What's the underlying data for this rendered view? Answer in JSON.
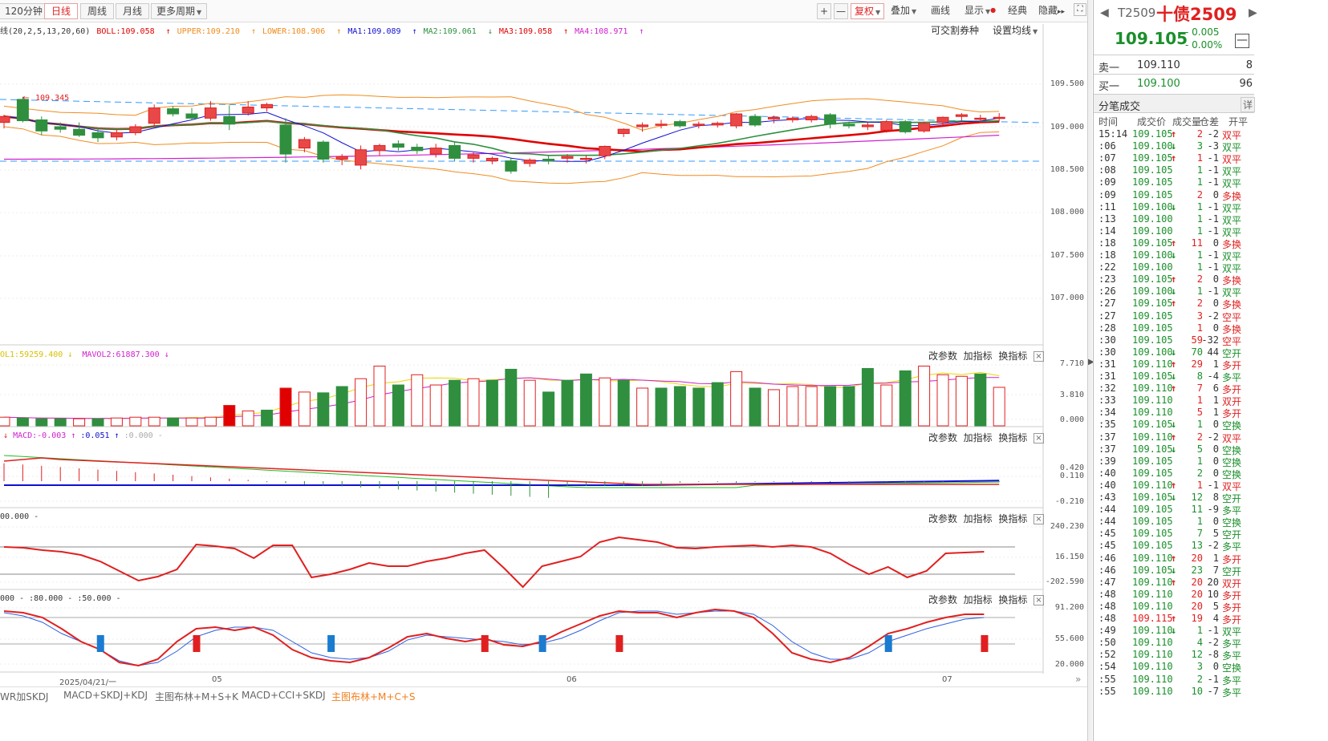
{
  "toolbar": {
    "period_tabs": [
      "120分钟",
      "日线",
      "周线",
      "月线",
      "更多周期"
    ],
    "active_period": "日线",
    "tools": [
      "复权",
      "叠加",
      "画线",
      "显示",
      "经典",
      "隐藏"
    ],
    "plus": "+",
    "minus": "—"
  },
  "main_indicator": {
    "boll": "线(20,2,5,13,20,60)",
    "boll_val": "BOLL:109.058",
    "upper": "UPPER:109.210",
    "lower": "LOWER:108.906",
    "ma1": "MA1:109.089",
    "ma2": "MA2:109.061",
    "ma3": "MA3:109.058",
    "ma4": "MA4:108.971",
    "tradable": "可交割券种",
    "set_ma": "设置均线",
    "high_mark": "109.345"
  },
  "price_axis": [
    "109.500",
    "109.000",
    "108.500",
    "108.000",
    "107.500",
    "107.000"
  ],
  "volume_panel": {
    "vol1": "OL1:59259.400",
    "mavol2": "MAVOL2:61887.300",
    "axis": [
      "7.710",
      "3.810",
      "0.000"
    ]
  },
  "macd_panel": {
    "macd": "MACD:-0.003",
    "dif": ":0.051",
    "dea": ":0.000",
    "axis": [
      "0.420",
      "0.110",
      "-0.210"
    ]
  },
  "cci_panel": {
    "label": "00.000",
    "axis": [
      "240.230",
      "16.150",
      "-202.590"
    ]
  },
  "kdj_panel": {
    "label1": "000",
    "label2": ":80.000",
    "label3": ":50.000",
    "axis": [
      "91.200",
      "55.600",
      "20.000"
    ]
  },
  "panel_controls": {
    "params": "改参数",
    "add": "加指标",
    "switch": "换指标",
    "close": "×"
  },
  "date_axis": [
    "2025/04/21/一",
    "05",
    "06",
    "07"
  ],
  "bottom_tabs": [
    "WR加SKDJ",
    "MACD+SKDJ+KDJ",
    "主图布林+M+S+K",
    "MACD+CCI+SKDJ",
    "主图布林+M+C+S"
  ],
  "active_bottom_tab": "主图布林+M+C+S",
  "quote": {
    "code": "T2509",
    "name": "十债2509",
    "price": "109.105",
    "change": "- 0.005",
    "change_pct": "- 0.00%",
    "ask_label": "卖一",
    "ask_price": "109.110",
    "ask_vol": "8",
    "bid_label": "买一",
    "bid_price": "109.100",
    "bid_vol": "96",
    "ticks_title": "分笔成交",
    "detail": "详",
    "headers": [
      "时间",
      "成交价",
      "成交量",
      "仓差",
      "开平"
    ]
  },
  "ticks": [
    [
      "15:14",
      "109.105",
      "↑",
      "2",
      "-2",
      "双平",
      "r"
    ],
    [
      ":06",
      "109.100",
      "↓",
      "3",
      "-3",
      "双平",
      "g"
    ],
    [
      ":07",
      "109.105",
      "↑",
      "1",
      "-1",
      "双平",
      "r"
    ],
    [
      ":08",
      "109.105",
      "",
      "1",
      "-1",
      "双平",
      "g"
    ],
    [
      ":09",
      "109.105",
      "",
      "1",
      "-1",
      "双平",
      "g"
    ],
    [
      ":09",
      "109.105",
      "",
      "2",
      "0",
      "多换",
      "r"
    ],
    [
      ":11",
      "109.100",
      "↓",
      "1",
      "-1",
      "双平",
      "g"
    ],
    [
      ":13",
      "109.100",
      "",
      "1",
      "-1",
      "双平",
      "g"
    ],
    [
      ":14",
      "109.100",
      "",
      "1",
      "-1",
      "双平",
      "g"
    ],
    [
      ":18",
      "109.105",
      "↑",
      "11",
      "0",
      "多换",
      "r"
    ],
    [
      ":18",
      "109.100",
      "↓",
      "1",
      "-1",
      "双平",
      "g"
    ],
    [
      ":22",
      "109.100",
      "",
      "1",
      "-1",
      "双平",
      "g"
    ],
    [
      ":23",
      "109.105",
      "↑",
      "2",
      "0",
      "多换",
      "r"
    ],
    [
      ":26",
      "109.100",
      "↓",
      "1",
      "-1",
      "双平",
      "g"
    ],
    [
      ":27",
      "109.105",
      "↑",
      "2",
      "0",
      "多换",
      "r"
    ],
    [
      ":27",
      "109.105",
      "",
      "3",
      "-2",
      "空平",
      "r"
    ],
    [
      ":28",
      "109.105",
      "",
      "1",
      "0",
      "多换",
      "r"
    ],
    [
      ":30",
      "109.105",
      "",
      "59",
      "-32",
      "空平",
      "r"
    ],
    [
      ":30",
      "109.100",
      "↓",
      "70",
      "44",
      "空开",
      "g"
    ],
    [
      ":31",
      "109.110",
      "↑",
      "29",
      "1",
      "多开",
      "r"
    ],
    [
      ":31",
      "109.105",
      "↓",
      "8",
      "-4",
      "多平",
      "g"
    ],
    [
      ":32",
      "109.110",
      "↑",
      "7",
      "6",
      "多开",
      "r"
    ],
    [
      ":33",
      "109.110",
      "",
      "1",
      "1",
      "双开",
      "r"
    ],
    [
      ":34",
      "109.110",
      "",
      "5",
      "1",
      "多开",
      "r"
    ],
    [
      ":35",
      "109.105",
      "↓",
      "1",
      "0",
      "空换",
      "g"
    ],
    [
      ":37",
      "109.110",
      "↑",
      "2",
      "-2",
      "双平",
      "r"
    ],
    [
      ":37",
      "109.105",
      "↓",
      "5",
      "0",
      "空换",
      "g"
    ],
    [
      ":39",
      "109.105",
      "",
      "1",
      "0",
      "空换",
      "g"
    ],
    [
      ":40",
      "109.105",
      "",
      "2",
      "0",
      "空换",
      "g"
    ],
    [
      ":40",
      "109.110",
      "↑",
      "1",
      "-1",
      "双平",
      "r"
    ],
    [
      ":43",
      "109.105",
      "↓",
      "12",
      "8",
      "空开",
      "g"
    ],
    [
      ":44",
      "109.105",
      "",
      "11",
      "-9",
      "多平",
      "g"
    ],
    [
      ":44",
      "109.105",
      "",
      "1",
      "0",
      "空换",
      "g"
    ],
    [
      ":45",
      "109.105",
      "",
      "7",
      "5",
      "空开",
      "g"
    ],
    [
      ":45",
      "109.105",
      "",
      "13",
      "-2",
      "多平",
      "g"
    ],
    [
      ":46",
      "109.110",
      "↑",
      "20",
      "1",
      "多开",
      "r"
    ],
    [
      ":46",
      "109.105",
      "↓",
      "23",
      "7",
      "空开",
      "g"
    ],
    [
      ":47",
      "109.110",
      "↑",
      "20",
      "20",
      "双开",
      "r"
    ],
    [
      ":48",
      "109.110",
      "",
      "20",
      "10",
      "多开",
      "r"
    ],
    [
      ":48",
      "109.110",
      "",
      "20",
      "5",
      "多开",
      "r"
    ],
    [
      ":48",
      "109.115",
      "↑",
      "19",
      "4",
      "多开",
      "r"
    ],
    [
      ":49",
      "109.110",
      "↓",
      "1",
      "-1",
      "双平",
      "g"
    ],
    [
      ":50",
      "109.110",
      "",
      "4",
      "-2",
      "多平",
      "g"
    ],
    [
      ":52",
      "109.110",
      "",
      "12",
      "-8",
      "多平",
      "g"
    ],
    [
      ":54",
      "109.110",
      "",
      "3",
      "0",
      "空换",
      "g"
    ],
    [
      ":55",
      "109.110",
      "",
      "2",
      "-1",
      "多平",
      "g"
    ],
    [
      ":55",
      "109.110",
      "",
      "10",
      "-7",
      "多平",
      "g"
    ]
  ],
  "colors": {
    "up": "#e02020",
    "down": "#2f8f3f",
    "ma1": "#1010d0",
    "upper": "#f08c20",
    "ma4": "#d020d0",
    "boll_mid": "#e00000"
  },
  "chart_data": {
    "type": "candlestick",
    "candles": [
      {
        "o": 109.05,
        "h": 109.14,
        "l": 108.98,
        "c": 109.12
      },
      {
        "o": 109.32,
        "h": 109.35,
        "l": 109.05,
        "c": 109.07
      },
      {
        "o": 109.08,
        "h": 109.12,
        "l": 108.9,
        "c": 108.95
      },
      {
        "o": 109.0,
        "h": 109.05,
        "l": 108.93,
        "c": 108.97
      },
      {
        "o": 108.97,
        "h": 109.05,
        "l": 108.88,
        "c": 108.9
      },
      {
        "o": 108.93,
        "h": 108.98,
        "l": 108.82,
        "c": 108.87
      },
      {
        "o": 108.88,
        "h": 108.96,
        "l": 108.84,
        "c": 108.93
      },
      {
        "o": 108.93,
        "h": 109.03,
        "l": 108.9,
        "c": 109.0
      },
      {
        "o": 109.04,
        "h": 109.26,
        "l": 109.0,
        "c": 109.22
      },
      {
        "o": 109.21,
        "h": 109.24,
        "l": 109.12,
        "c": 109.15
      },
      {
        "o": 109.15,
        "h": 109.22,
        "l": 109.08,
        "c": 109.1
      },
      {
        "o": 109.1,
        "h": 109.3,
        "l": 109.07,
        "c": 109.22
      },
      {
        "o": 109.12,
        "h": 109.25,
        "l": 108.96,
        "c": 109.03
      },
      {
        "o": 109.16,
        "h": 109.3,
        "l": 109.13,
        "c": 109.23
      },
      {
        "o": 109.22,
        "h": 109.28,
        "l": 109.18,
        "c": 109.26
      },
      {
        "o": 109.02,
        "h": 109.1,
        "l": 108.58,
        "c": 108.68
      },
      {
        "o": 108.75,
        "h": 108.88,
        "l": 108.7,
        "c": 108.85
      },
      {
        "o": 108.82,
        "h": 108.84,
        "l": 108.58,
        "c": 108.62
      },
      {
        "o": 108.62,
        "h": 108.68,
        "l": 108.55,
        "c": 108.65
      },
      {
        "o": 108.55,
        "h": 108.78,
        "l": 108.5,
        "c": 108.73
      },
      {
        "o": 108.72,
        "h": 108.8,
        "l": 108.66,
        "c": 108.78
      },
      {
        "o": 108.8,
        "h": 108.84,
        "l": 108.72,
        "c": 108.76
      },
      {
        "o": 108.76,
        "h": 108.8,
        "l": 108.68,
        "c": 108.72
      },
      {
        "o": 108.68,
        "h": 108.8,
        "l": 108.64,
        "c": 108.75
      },
      {
        "o": 108.78,
        "h": 108.82,
        "l": 108.6,
        "c": 108.63
      },
      {
        "o": 108.63,
        "h": 108.7,
        "l": 108.58,
        "c": 108.67
      },
      {
        "o": 108.6,
        "h": 108.65,
        "l": 108.56,
        "c": 108.63
      },
      {
        "o": 108.6,
        "h": 108.64,
        "l": 108.45,
        "c": 108.48
      },
      {
        "o": 108.57,
        "h": 108.63,
        "l": 108.53,
        "c": 108.61
      },
      {
        "o": 108.62,
        "h": 108.66,
        "l": 108.56,
        "c": 108.6
      },
      {
        "o": 108.63,
        "h": 108.68,
        "l": 108.58,
        "c": 108.65
      },
      {
        "o": 108.63,
        "h": 108.66,
        "l": 108.57,
        "c": 108.63
      },
      {
        "o": 108.66,
        "h": 108.78,
        "l": 108.62,
        "c": 108.77
      },
      {
        "o": 108.92,
        "h": 108.98,
        "l": 108.88,
        "c": 108.97
      },
      {
        "o": 109.0,
        "h": 109.05,
        "l": 108.94,
        "c": 109.02
      },
      {
        "o": 109.02,
        "h": 109.08,
        "l": 108.98,
        "c": 109.03
      },
      {
        "o": 109.06,
        "h": 109.08,
        "l": 108.99,
        "c": 109.01
      },
      {
        "o": 109.02,
        "h": 109.06,
        "l": 108.98,
        "c": 109.03
      },
      {
        "o": 109.02,
        "h": 109.06,
        "l": 108.99,
        "c": 109.04
      },
      {
        "o": 109.01,
        "h": 109.16,
        "l": 108.98,
        "c": 109.15
      },
      {
        "o": 109.12,
        "h": 109.15,
        "l": 109.0,
        "c": 109.02
      },
      {
        "o": 109.09,
        "h": 109.13,
        "l": 109.04,
        "c": 109.11
      },
      {
        "o": 109.08,
        "h": 109.12,
        "l": 109.05,
        "c": 109.1
      },
      {
        "o": 109.08,
        "h": 109.14,
        "l": 109.05,
        "c": 109.12
      },
      {
        "o": 109.14,
        "h": 109.16,
        "l": 108.98,
        "c": 109.03
      },
      {
        "o": 109.03,
        "h": 109.06,
        "l": 108.98,
        "c": 109.01
      },
      {
        "o": 109.0,
        "h": 109.05,
        "l": 108.96,
        "c": 109.02
      },
      {
        "o": 108.96,
        "h": 109.08,
        "l": 108.93,
        "c": 109.06
      },
      {
        "o": 109.06,
        "h": 109.08,
        "l": 108.92,
        "c": 108.94
      },
      {
        "o": 108.95,
        "h": 109.06,
        "l": 108.93,
        "c": 109.04
      },
      {
        "o": 109.05,
        "h": 109.12,
        "l": 109.02,
        "c": 109.11
      },
      {
        "o": 109.12,
        "h": 109.16,
        "l": 109.07,
        "c": 109.14
      },
      {
        "o": 109.1,
        "h": 109.14,
        "l": 109.06,
        "c": 109.1
      },
      {
        "o": 109.1,
        "h": 109.16,
        "l": 109.06,
        "c": 109.11
      }
    ],
    "volume_up": [
      1,
      0,
      0,
      0,
      1,
      0,
      1,
      1,
      1,
      0,
      1,
      1,
      1,
      1,
      0,
      1,
      1,
      0,
      0,
      1,
      1,
      0,
      1,
      1,
      0,
      1,
      0,
      0,
      1,
      0,
      0,
      0,
      1,
      0,
      1,
      0,
      0,
      0,
      0,
      1,
      0,
      1,
      1,
      1,
      0,
      0,
      0,
      1,
      0,
      1,
      1,
      1,
      0,
      1
    ],
    "volume": [
      1.1,
      1.0,
      0.9,
      0.9,
      0.9,
      0.9,
      1.0,
      1.1,
      1.1,
      1.0,
      1.0,
      1.1,
      2.6,
      1.9,
      2.0,
      4.8,
      4.3,
      4.2,
      5.0,
      6.0,
      7.6,
      5.2,
      6.5,
      5.2,
      5.8,
      6.0,
      5.8,
      7.2,
      5.8,
      4.3,
      5.8,
      6.6,
      6.1,
      5.8,
      4.8,
      4.8,
      5.0,
      4.8,
      5.5,
      6.9,
      4.8,
      4.6,
      5.0,
      5.0,
      5.0,
      5.0,
      7.3,
      5.2,
      7.0,
      7.6,
      6.5,
      6.3,
      6.6,
      4.9
    ]
  }
}
